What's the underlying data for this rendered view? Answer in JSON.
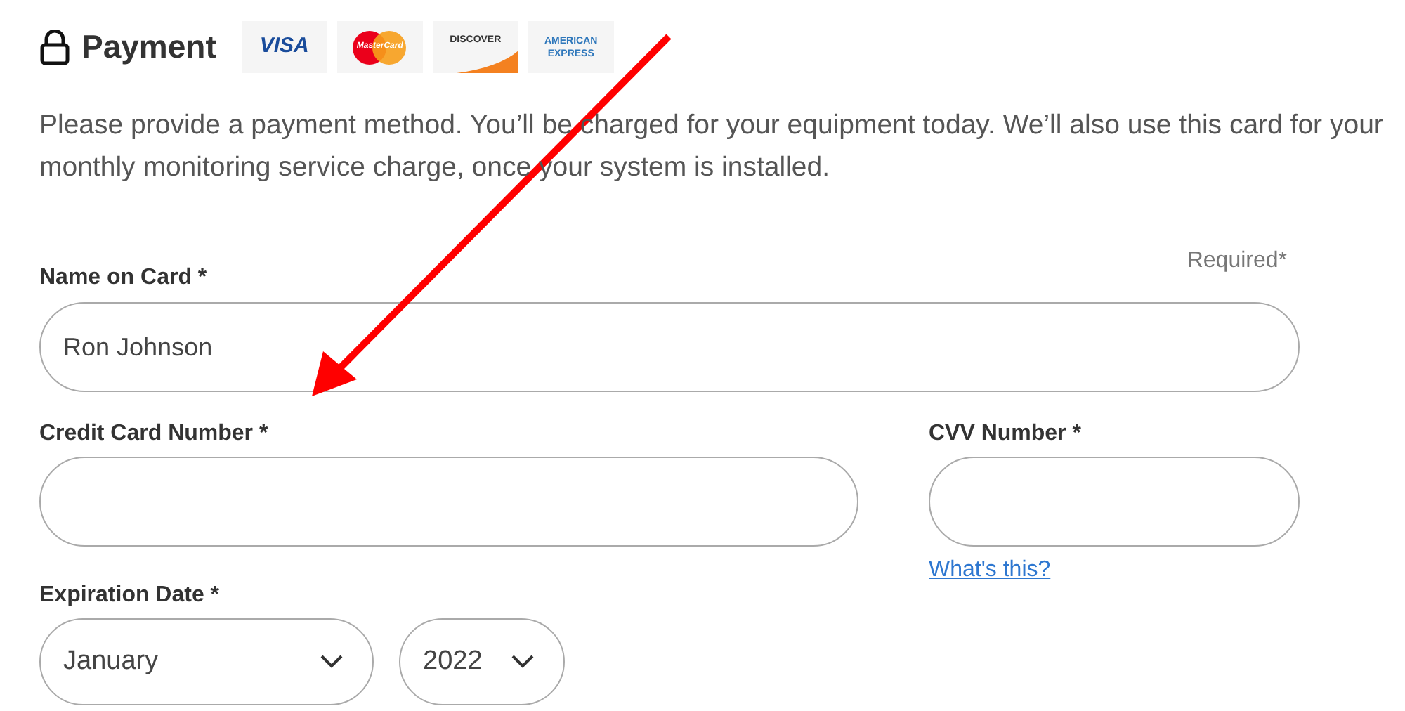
{
  "header": {
    "title": "Payment"
  },
  "cards": [
    {
      "kind": "visa",
      "label": "VISA"
    },
    {
      "kind": "mastercard",
      "label": "MasterCard"
    },
    {
      "kind": "discover",
      "label": "DISCOVER"
    },
    {
      "kind": "amex",
      "label": "AMERICAN EXPRESS"
    }
  ],
  "intro": "Please provide a payment method. You’ll be charged for your equipment today. We’ll also use this card for your monthly monitoring service charge, once your system is installed.",
  "required_note": "Required*",
  "name_field": {
    "label": "Name on Card *",
    "value": "Ron Johnson"
  },
  "card_number_field": {
    "label": "Credit Card Number *"
  },
  "cvv_field": {
    "label": "CVV Number *",
    "help_link": "What's this?"
  },
  "expiration": {
    "label": "Expiration Date *",
    "month": "January",
    "year": "2022"
  }
}
